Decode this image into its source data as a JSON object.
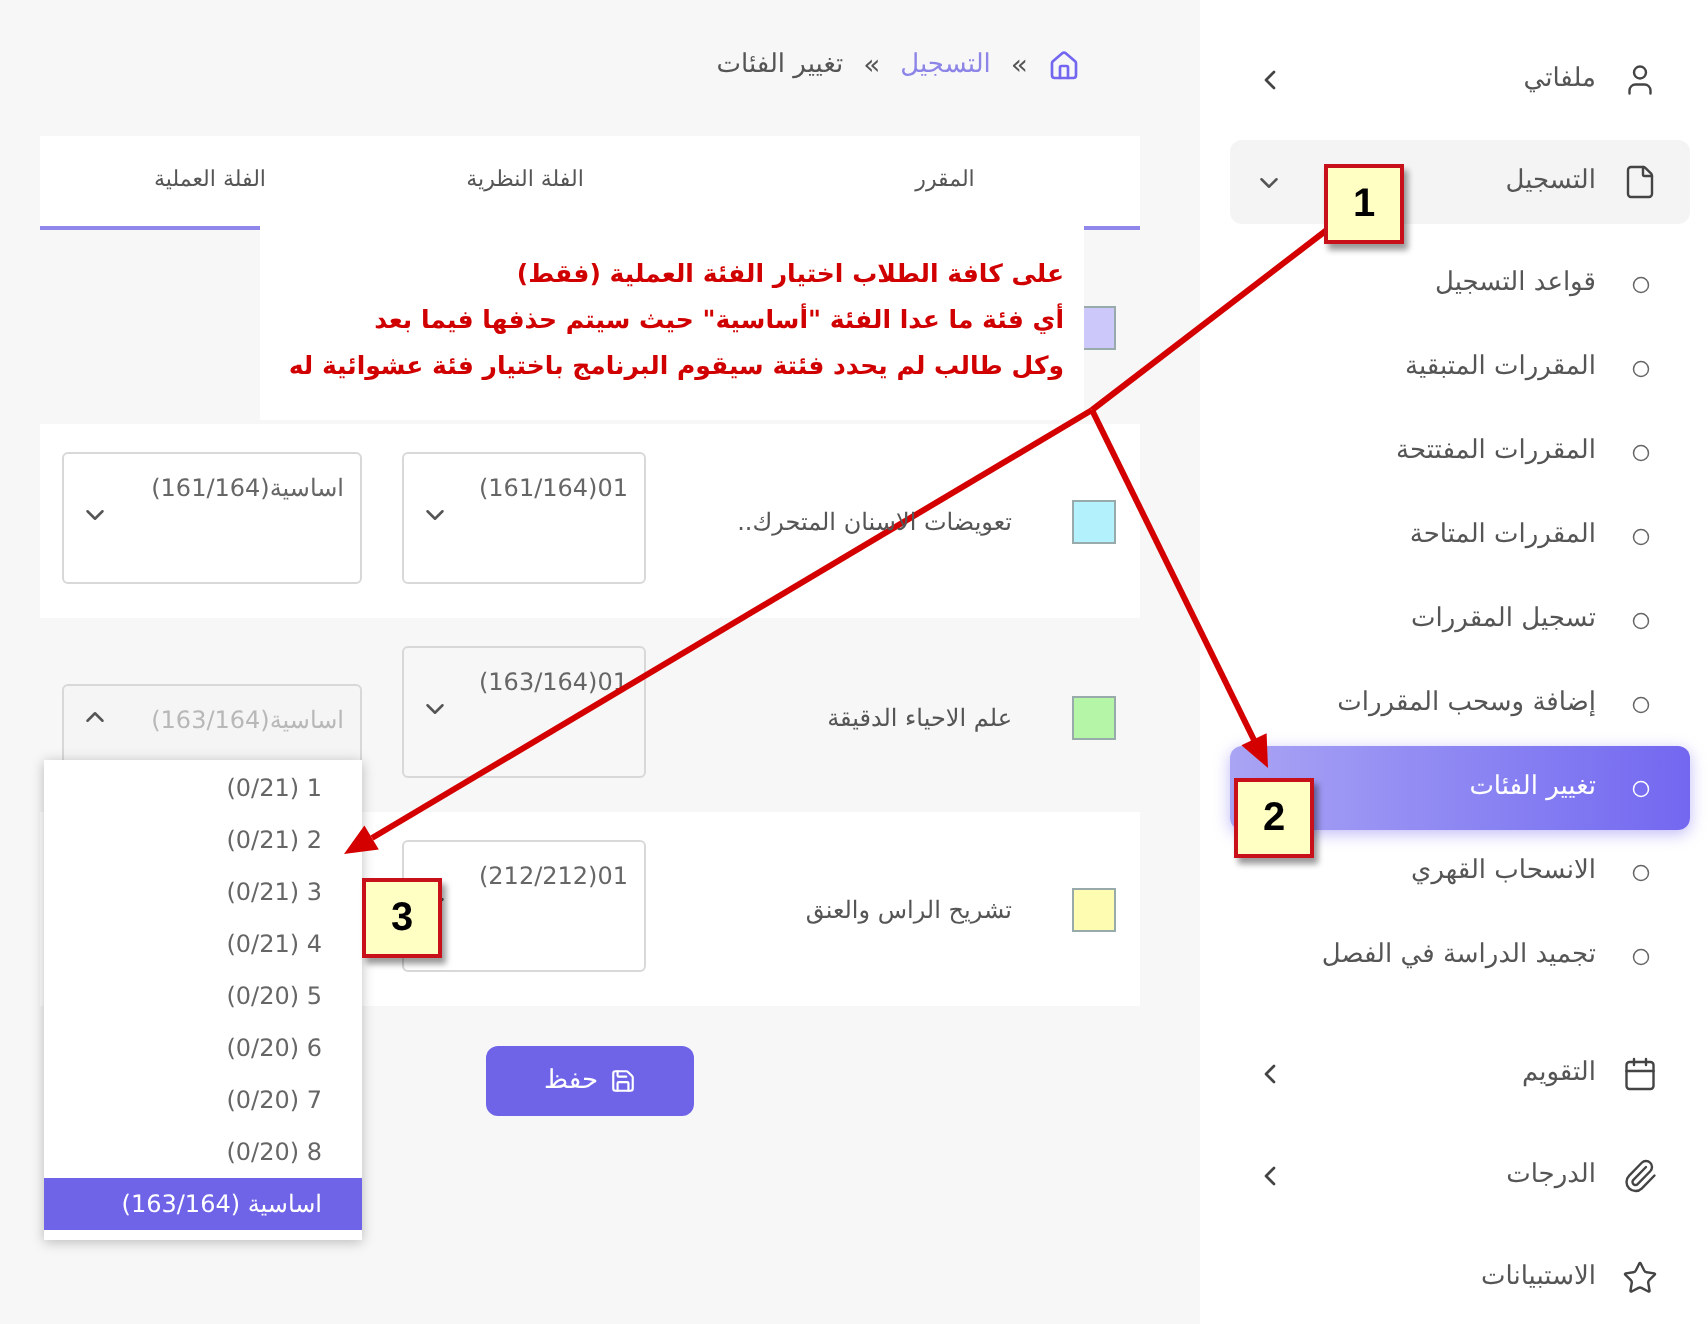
{
  "sidebar": {
    "items": [
      {
        "kind": "group",
        "label": "ملفاتي",
        "expanded": false
      },
      {
        "kind": "group",
        "label": "التسجيل",
        "expanded": true,
        "children": [
          {
            "label": "قواعد التسجيل",
            "selected": false
          },
          {
            "label": "المقررات المتبقية",
            "selected": false
          },
          {
            "label": "المقررات المفتتحة",
            "selected": false
          },
          {
            "label": "المقررات المتاحة",
            "selected": false
          },
          {
            "label": "تسجيل المقررات",
            "selected": false
          },
          {
            "label": "إضافة وسحب المقررات",
            "selected": false
          },
          {
            "label": "تغيير الفئات",
            "selected": true
          },
          {
            "label": "الانسحاب القهري",
            "selected": false
          },
          {
            "label": "تجميد الدراسة في الفصل",
            "selected": false
          }
        ]
      },
      {
        "kind": "group",
        "label": "التقويم",
        "expanded": false
      },
      {
        "kind": "group",
        "label": "الدرجات",
        "expanded": false
      },
      {
        "kind": "link",
        "label": "الاستبيانات"
      }
    ]
  },
  "breadcrumb": [
    {
      "kind": "home"
    },
    {
      "kind": "separator",
      "text": "»"
    },
    {
      "kind": "link",
      "text": "التسجيل"
    },
    {
      "kind": "separator",
      "text": "»"
    },
    {
      "kind": "current",
      "text": "تغيير الفئات"
    }
  ],
  "table": {
    "columns": [
      "المقرر",
      "الفلة النظرية",
      "الفلة العملية"
    ],
    "rows": [
      {
        "color": "#cdc8fa"
      },
      {
        "color": "#b3f1fd",
        "course": "تعويضات الاسنان المتحرك..",
        "theory": {
          "value": "01(161/164)",
          "open": false
        },
        "practical": {
          "value": "اساسية(161/164)",
          "open": false
        }
      },
      {
        "color": "#b4f5a8",
        "course": "علم الاحياء الدقيقة",
        "theory": {
          "value": "01(163/164)",
          "open": false
        },
        "practical": {
          "value": "اساسية(163/164)",
          "open": true,
          "options": [
            {
              "label": "1 (0/21)",
              "selected": false
            },
            {
              "label": "2 (0/21)",
              "selected": false
            },
            {
              "label": "3 (0/21)",
              "selected": false
            },
            {
              "label": "4 (0/21)",
              "selected": false
            },
            {
              "label": "5 (0/20)",
              "selected": false
            },
            {
              "label": "6 (0/20)",
              "selected": false
            },
            {
              "label": "7 (0/20)",
              "selected": false
            },
            {
              "label": "8 (0/20)",
              "selected": false
            },
            {
              "label": "اساسية (163/164)",
              "selected": true
            }
          ]
        }
      },
      {
        "color": "#fdfcb0",
        "course": "تشريح الراس والعنق",
        "theory": {
          "value": "01(212/212)",
          "open": false
        }
      }
    ]
  },
  "save_button": "حفظ",
  "annotations": {
    "note": [
      "على كافة الطلاب اختيار الفئة العملية (فقط)",
      "أي فئة ما عدا الفئة \"أساسية\" حيث سيتم حذفها فيما بعد",
      "وكل طالب لم يحدد فئتة سيقوم البرنامج باختيار فئة عشوائية له"
    ],
    "callouts": [
      "1",
      "2",
      "3"
    ]
  }
}
